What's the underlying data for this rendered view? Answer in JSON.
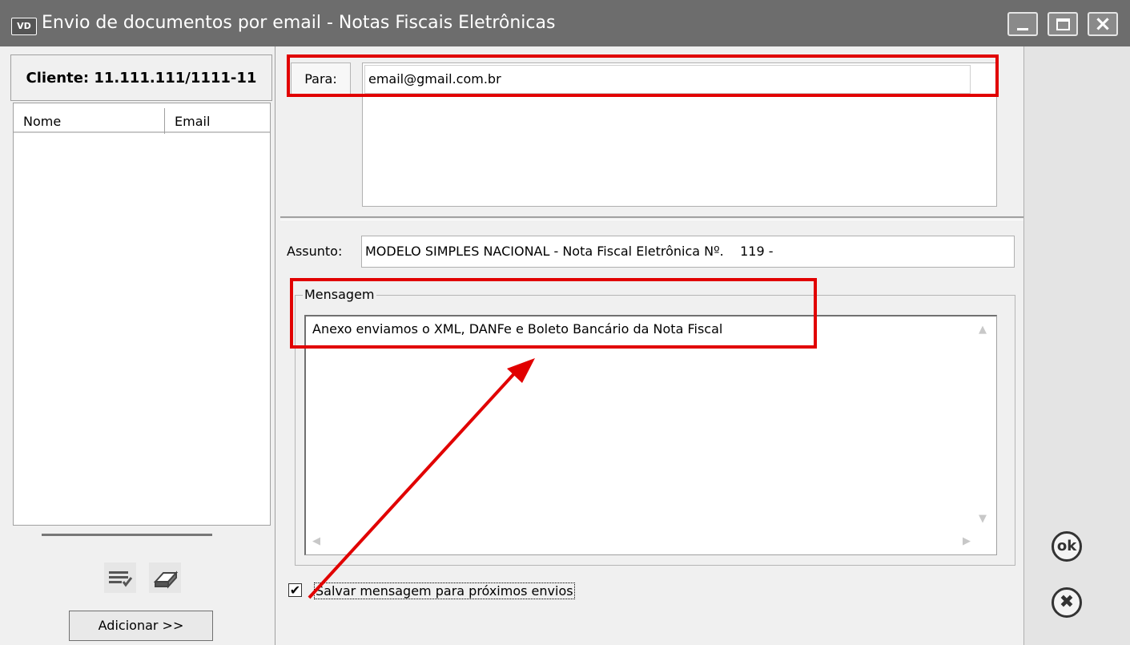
{
  "window": {
    "icon_label": "VD",
    "title": "Envio de documentos por email - Notas Fiscais Eletrônicas"
  },
  "client": {
    "label": "Cliente: 11.111.111/1111-11"
  },
  "contacts_table": {
    "columns": [
      "Nome",
      "Email"
    ],
    "rows": []
  },
  "left_toolbar": {
    "icons": [
      "checklist-icon",
      "eraser-icon"
    ],
    "add_button_label": "Adicionar >>"
  },
  "recipients": {
    "label": "Para:",
    "value": "email@gmail.com.br"
  },
  "subject": {
    "label": "Assunto:",
    "value": "MODELO SIMPLES NACIONAL - Nota Fiscal Eletrônica Nº.    119 -"
  },
  "message": {
    "group_label": "Mensagem",
    "text": "Anexo enviamos o XML, DANFe e Boleto Bancário da Nota Fiscal"
  },
  "save_option": {
    "label": "Salvar mensagem para próximos envios",
    "checked": true,
    "check_glyph": "✔"
  },
  "actions": {
    "ok_label": "ok",
    "cancel_glyph": "✖"
  },
  "annotation_color": "#e10000"
}
